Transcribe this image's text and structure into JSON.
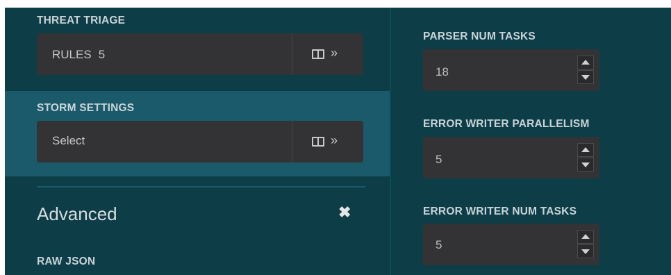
{
  "left": {
    "threat_triage": {
      "label": "THREAT TRIAGE",
      "rules_label": "RULES",
      "rules_count": "5",
      "toggle_glyph": "»"
    },
    "storm_settings": {
      "label": "STORM SETTINGS",
      "placeholder": "Select",
      "toggle_glyph": "»"
    },
    "advanced": {
      "title": "Advanced",
      "close_glyph": "✖"
    },
    "raw_json": {
      "label": "RAW JSON"
    }
  },
  "right": {
    "parser_num_tasks": {
      "label": "PARSER NUM TASKS",
      "value": "18"
    },
    "error_writer_parallelism": {
      "label": "ERROR WRITER PARALLELISM",
      "value": "5"
    },
    "error_writer_num_tasks": {
      "label": "ERROR WRITER NUM TASKS",
      "value": "5"
    }
  },
  "colors": {
    "panel_bg": "#0d3d47",
    "highlight_bg": "#1a5a6b",
    "input_bg": "#333335",
    "label_text": "#c9d4d8"
  },
  "icons": [
    "columns-icon",
    "chevrons-right-icon",
    "close-icon",
    "caret-up-icon",
    "caret-down-icon"
  ]
}
